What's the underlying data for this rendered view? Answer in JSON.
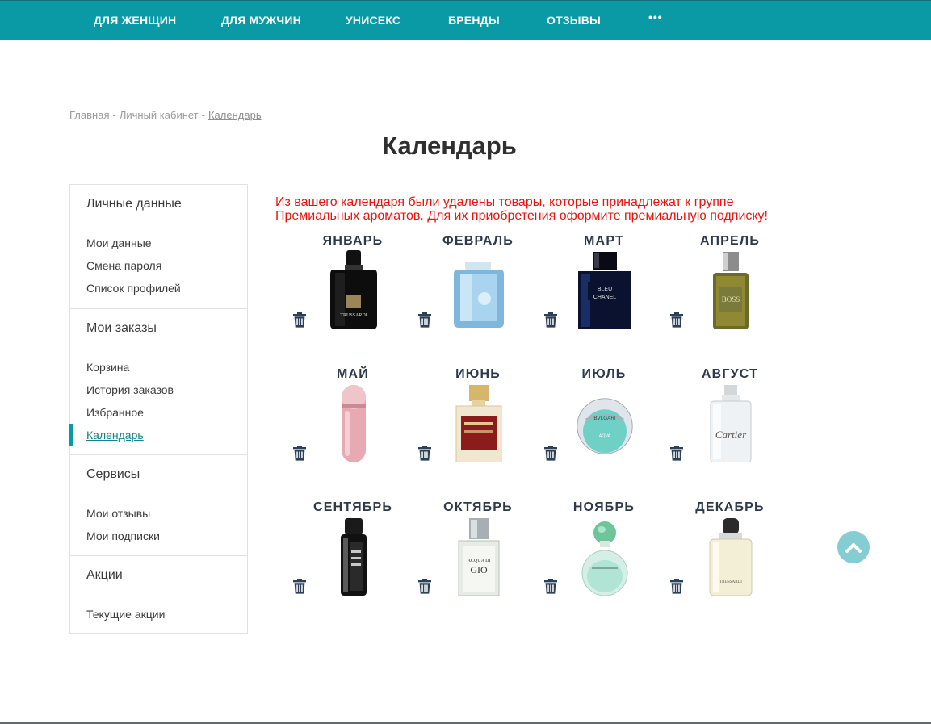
{
  "nav": {
    "items": [
      "ДЛЯ ЖЕНЩИН",
      "ДЛЯ МУЖЧИН",
      "УНИСЕКС",
      "БРЕНДЫ",
      "ОТЗЫВЫ"
    ],
    "more": "•••",
    "colors": {
      "bar": "#0a9aa6"
    }
  },
  "breadcrumb": {
    "home": "Главная",
    "sep": "-",
    "account": "Личный кабинет",
    "current": "Календарь"
  },
  "page": {
    "title": "Календарь"
  },
  "sidebar": {
    "personal": {
      "heading": "Личные данные",
      "links": [
        "Мои данные",
        "Смена пароля",
        "Список профилей"
      ]
    },
    "orders": {
      "heading": "Мои заказы",
      "links": [
        "Корзина",
        "История заказов",
        "Избранное",
        "Календарь"
      ]
    },
    "services": {
      "heading": "Сервисы",
      "links": [
        "Мои отзывы",
        "Мои подписки"
      ]
    },
    "promos": {
      "heading": "Акции",
      "links": [
        "Текущие акции"
      ]
    }
  },
  "notice": {
    "text": "Из вашего календаря были удалены товары, которые принадлежат к группе Премиальных ароматов. Для их приобретения оформите премиальную подписку!",
    "color": "#ee1111"
  },
  "calendar": {
    "months": [
      {
        "name": "ЯНВАРЬ",
        "product_icon": "trussardi-black-bottle",
        "label": "TRUSSARDI"
      },
      {
        "name": "ФЕВРАЛЬ",
        "product_icon": "blue-flat-bottle",
        "label": ""
      },
      {
        "name": "МАРТ",
        "product_icon": "bleu-de-chanel-bottle",
        "label": "BLEU\nCHANEL"
      },
      {
        "name": "АПРЕЛЬ",
        "product_icon": "boss-bottled-bottle",
        "label": "BOSS"
      },
      {
        "name": "МАЙ",
        "product_icon": "pink-capsule-bottle",
        "label": ""
      },
      {
        "name": "ИЮНЬ",
        "product_icon": "baccarat-square-bottle",
        "label": ""
      },
      {
        "name": "ИЮЛЬ",
        "product_icon": "bvlgari-aqva-bottle",
        "label": "BVLGARI\nAQVA"
      },
      {
        "name": "АВГУСТ",
        "product_icon": "cartier-clear-bottle",
        "label": "Cartier"
      },
      {
        "name": "СЕНТЯБРЬ",
        "product_icon": "212-black-bottle",
        "label": ""
      },
      {
        "name": "ОКТЯБРЬ",
        "product_icon": "acqua-di-gio-bottle",
        "label": "ACQUA DI\nGIO"
      },
      {
        "name": "НОЯБРЬ",
        "product_icon": "green-stone-bottle",
        "label": ""
      },
      {
        "name": "ДЕКАБРЬ",
        "product_icon": "trussardi-white-bottle",
        "label": "TRUSSARDI"
      }
    ]
  },
  "icons": {
    "delete": "trash-icon",
    "scroll_top": "chevron-up-icon"
  }
}
